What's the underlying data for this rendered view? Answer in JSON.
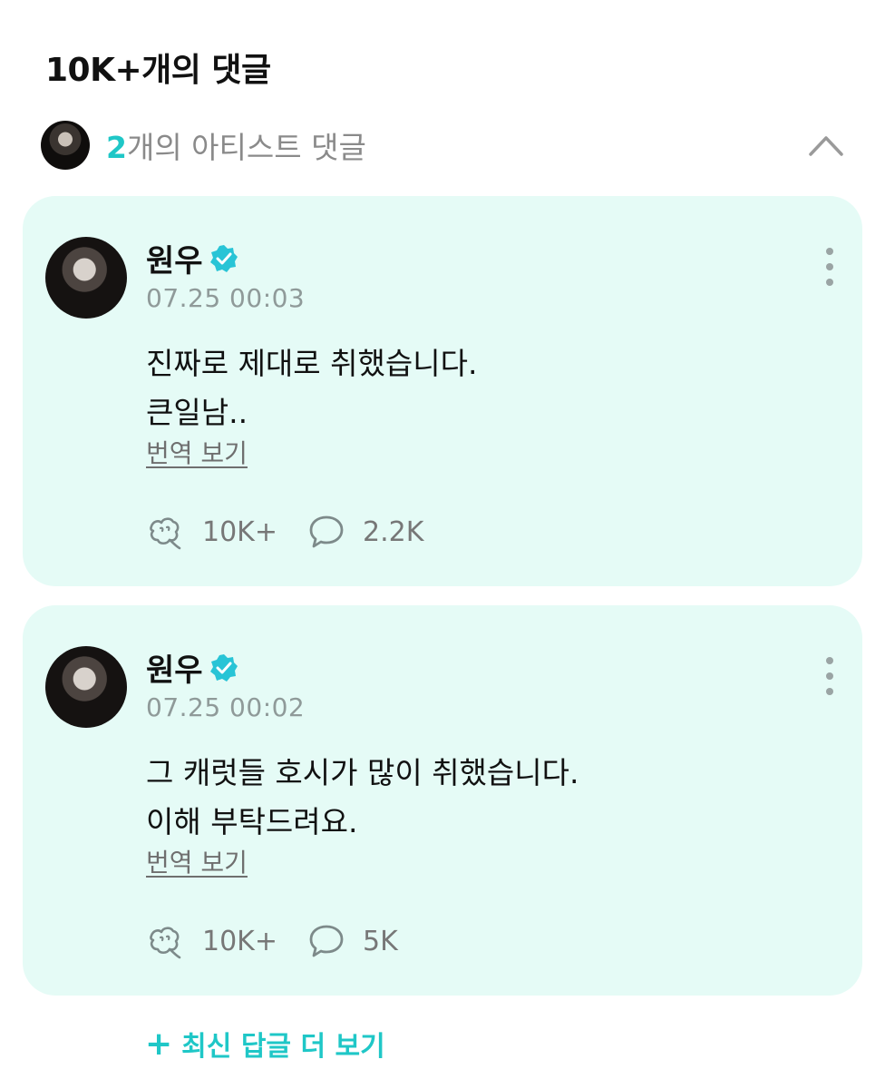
{
  "header": {
    "title": "10K+개의 댓글"
  },
  "artist_section": {
    "count": "2",
    "label_suffix": "개의 아티스트 댓글"
  },
  "comments": [
    {
      "author": "원우",
      "time": "07.25 00:03",
      "text": "진짜로 제대로 취했습니다.\n큰일남..",
      "translate": "번역 보기",
      "likes": "10K+",
      "replies": "2.2K"
    },
    {
      "author": "원우",
      "time": "07.25 00:02",
      "text": "그 캐럿들 호시가 많이 취했습니다.\n이해 부탁드려요.",
      "translate": "번역 보기",
      "likes": "10K+",
      "replies": "5K"
    }
  ],
  "more_replies": {
    "label": "최신 답글 더 보기"
  },
  "colors": {
    "accent": "#1fc7c7",
    "card_bg": "#e5fbf6",
    "muted": "#8f9a99"
  },
  "icons": [
    "chevron-up-icon",
    "verified-badge-icon",
    "more-vertical-icon",
    "like-icon",
    "comment-bubble-icon",
    "plus-icon"
  ]
}
